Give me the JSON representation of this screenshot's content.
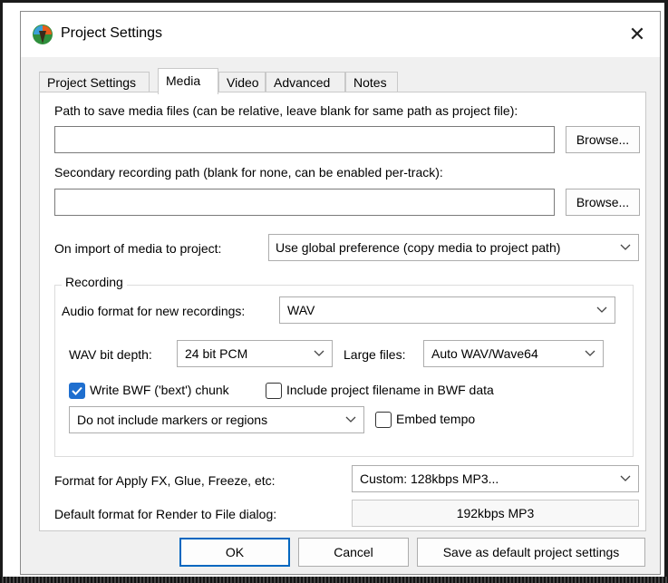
{
  "window": {
    "title": "Project Settings",
    "close_symbol": "✕",
    "icon": "reaper-app-icon"
  },
  "tabs": [
    {
      "label": "Project Settings",
      "active": false
    },
    {
      "label": "Media",
      "active": true
    },
    {
      "label": "Video",
      "active": false
    },
    {
      "label": "Advanced",
      "active": false
    },
    {
      "label": "Notes",
      "active": false
    }
  ],
  "media": {
    "path_label": "Path to save media files (can be relative, leave blank for same path as project file):",
    "path_value": "",
    "browse_label": "Browse...",
    "secondary_label": "Secondary recording path (blank for none, can be enabled per-track):",
    "secondary_value": "",
    "browse2_label": "Browse...",
    "import_label": "On import of media to project:",
    "import_value": "Use global preference (copy media to project path)",
    "recording": {
      "group_label": "Recording",
      "audio_format_label": "Audio format for new recordings:",
      "audio_format_value": "WAV",
      "bit_depth_label": "WAV bit depth:",
      "bit_depth_value": "24 bit PCM",
      "large_files_label": "Large files:",
      "large_files_value": "Auto WAV/Wave64",
      "write_bwf_label": "Write BWF ('bext') chunk",
      "write_bwf_checked": true,
      "include_filename_label": "Include project filename in BWF data",
      "include_filename_checked": false,
      "markers_value": "Do not include markers or regions",
      "embed_tempo_label": "Embed tempo",
      "embed_tempo_checked": false
    },
    "apply_fx_label": "Format for Apply FX, Glue, Freeze, etc:",
    "apply_fx_value": "Custom: 128kbps MP3...",
    "render_label": "Default format for Render to File dialog:",
    "render_value": "192kbps MP3"
  },
  "footer": {
    "ok_label": "OK",
    "cancel_label": "Cancel",
    "save_default_label": "Save as default project settings"
  },
  "colors": {
    "accent": "#0067c0",
    "checkbox_checked": "#1f6fcf"
  }
}
